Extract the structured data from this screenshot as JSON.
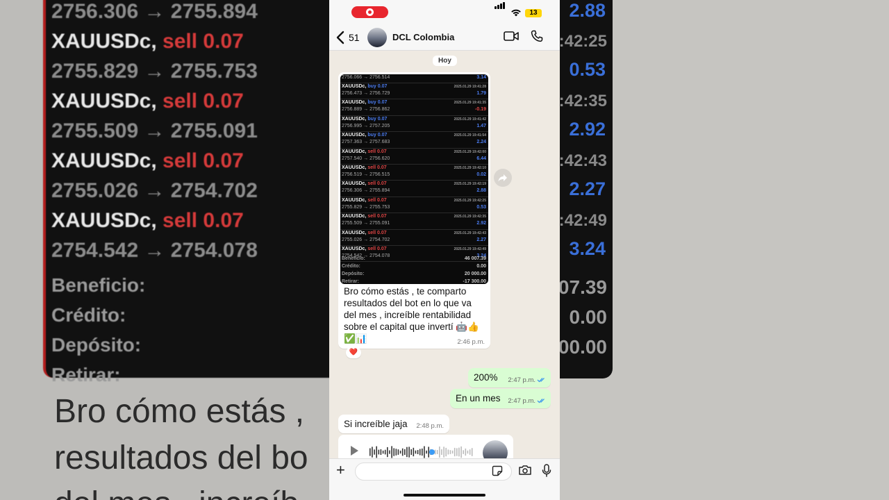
{
  "background": {
    "left_rows": [
      {
        "kind": "line",
        "text": "2756.306 → 2755.894"
      },
      {
        "kind": "sym",
        "symbol": "XAUUSDc,",
        "side": "sell 0.07"
      },
      {
        "kind": "line",
        "text": "2755.829 → 2755.753"
      },
      {
        "kind": "sym",
        "symbol": "XAUUSDc,",
        "side": "sell 0.07"
      },
      {
        "kind": "line",
        "text": "2755.509 → 2755.091"
      },
      {
        "kind": "sym",
        "symbol": "XAUUSDc,",
        "side": "sell 0.07"
      },
      {
        "kind": "line",
        "text": "2755.026 → 2754.702"
      },
      {
        "kind": "sym",
        "symbol": "XAUUSDc,",
        "side": "sell 0.07"
      },
      {
        "kind": "line",
        "text": "2754.542 → 2754.078"
      }
    ],
    "left_labels": [
      "Beneficio:",
      "Crédito:",
      "Depósito:",
      "Retirar:"
    ],
    "caption_lines": [
      "Bro cómo estás ,",
      "resultados del bo",
      "del mes , increíb"
    ],
    "right_profits": [
      "2.88",
      "0.53",
      "2.92",
      "2.27",
      "3.24"
    ],
    "right_times": [
      "9:42:25",
      "9:42:35",
      "9:42:43",
      "9:42:49"
    ],
    "right_summary": [
      "07.39",
      "0.00",
      "00.00"
    ]
  },
  "status_bar": {
    "battery": "13"
  },
  "chat": {
    "back_count": "51",
    "name": "DCL Colombia",
    "day_label": "Hoy"
  },
  "trade_screenshot": {
    "first_row": {
      "prices": "2756.066 → 2756.514",
      "profit": "3.14"
    },
    "rows": [
      {
        "symbol": "XAUUSDc,",
        "side": "buy 0.07",
        "side_type": "buy",
        "time": "2025.01.29 19:41:28",
        "prices": "2756.473 → 2756.729",
        "profit": "1.79"
      },
      {
        "symbol": "XAUUSDc,",
        "side": "buy 0.07",
        "side_type": "buy",
        "time": "2025.01.29 19:41:35",
        "prices": "2756.889 → 2756.862",
        "profit": "-0.19"
      },
      {
        "symbol": "XAUUSDc,",
        "side": "buy 0.07",
        "side_type": "buy",
        "time": "2025.01.29 19:41:42",
        "prices": "2756.995 → 2757.205",
        "profit": "1.47"
      },
      {
        "symbol": "XAUUSDc,",
        "side": "buy 0.07",
        "side_type": "buy",
        "time": "2025.01.29 19:41:54",
        "prices": "2757.363 → 2757.683",
        "profit": "2.24"
      },
      {
        "symbol": "XAUUSDc,",
        "side": "sell 0.07",
        "side_type": "sell",
        "time": "2025.01.29 19:42:00",
        "prices": "2757.540 → 2756.620",
        "profit": "6.44"
      },
      {
        "symbol": "XAUUSDc,",
        "side": "sell 0.07",
        "side_type": "sell",
        "time": "2025.01.29 19:42:10",
        "prices": "2756.519 → 2756.515",
        "profit": "0.02"
      },
      {
        "symbol": "XAUUSDc,",
        "side": "sell 0.07",
        "side_type": "sell",
        "time": "2025.01.29 19:42:19",
        "prices": "2756.306 → 2755.894",
        "profit": "2.88"
      },
      {
        "symbol": "XAUUSDc,",
        "side": "sell 0.07",
        "side_type": "sell",
        "time": "2025.01.29 19:42:25",
        "prices": "2755.829 → 2755.753",
        "profit": "0.53"
      },
      {
        "symbol": "XAUUSDc,",
        "side": "sell 0.07",
        "side_type": "sell",
        "time": "2025.01.29 19:42:35",
        "prices": "2755.509 → 2755.091",
        "profit": "2.92"
      },
      {
        "symbol": "XAUUSDc,",
        "side": "sell 0.07",
        "side_type": "sell",
        "time": "2025.01.29 19:42:43",
        "prices": "2755.026 → 2754.702",
        "profit": "2.27"
      },
      {
        "symbol": "XAUUSDc,",
        "side": "sell 0.07",
        "side_type": "sell",
        "time": "2025.01.29 19:42:49",
        "prices": "2754.542 → 2754.078",
        "profit": "3.24"
      }
    ],
    "summary": [
      {
        "label": "Beneficio:",
        "value": "46 007.39"
      },
      {
        "label": "Crédito:",
        "value": "0.00"
      },
      {
        "label": "Depósito:",
        "value": "20 000.00"
      },
      {
        "label": "Retirar:",
        "value": "-17 300.00"
      }
    ]
  },
  "messages": {
    "image_caption": "Bro cómo estás , te comparto resultados del bot en lo que va del mes , increíble rentabilidad sobre el capital que invertí 🤖👍✅📊",
    "image_time": "2:46 p.m.",
    "reaction": "❤️",
    "out1_text": "200%",
    "out1_time": "2:47 p.m.",
    "out2_text": "En un mes",
    "out2_time": "2:47 p.m.",
    "in2_text": "Si increíble jaja",
    "in2_time": "2:48 p.m.",
    "voice_progress": 0.6
  }
}
